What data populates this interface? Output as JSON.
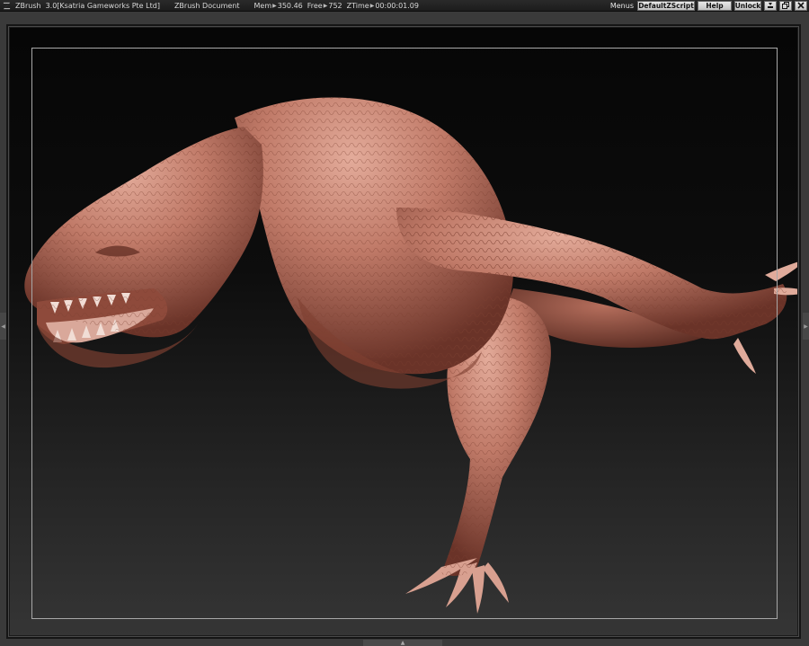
{
  "titlebar": {
    "app_name": "ZBrush",
    "version_company": "3.0[Ksatria Gameworks Pte Ltd]",
    "document_name": "ZBrush Document",
    "mem_label": "Mem",
    "mem_value": "350.46",
    "free_label": "Free",
    "free_value": "752",
    "ztime_label": "ZTime",
    "ztime_value": "00:00:01.09",
    "menus_label": "Menus",
    "script_button": "DefaultZScript",
    "help_button": "Help",
    "unlock_button": "Unlock",
    "minimize_icon": "minimize-icon",
    "restore_icon": "restore-icon",
    "close_icon": "close-icon"
  },
  "canvas": {
    "content": "sculpted reptile creature model",
    "model_color": "#c07a68",
    "background_top": "#060606",
    "background_bottom": "#353535",
    "frame_color": "#a8a8a8"
  }
}
